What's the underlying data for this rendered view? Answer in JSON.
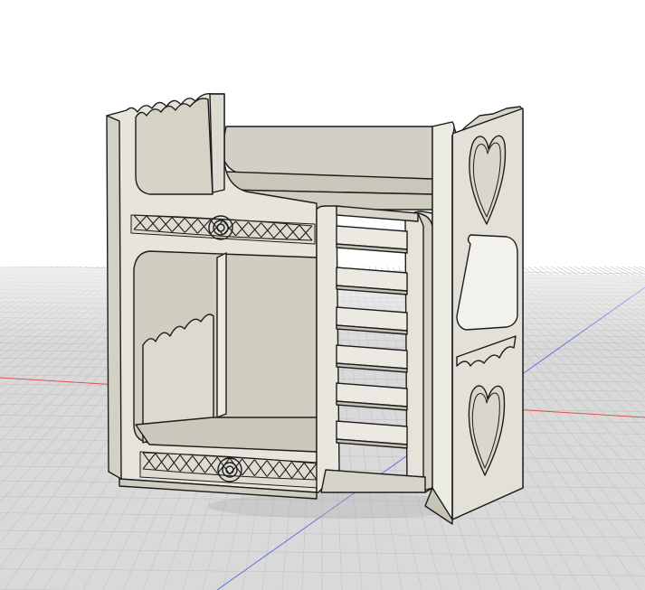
{
  "viewport": {
    "background": "#ffffff",
    "grid_color": "#c8c8c8",
    "grid_fill": "#d6d6d6",
    "x_axis_color": "#e05050",
    "y_axis_color": "#5a6ee0"
  },
  "model": {
    "body_color": "#e8e6de",
    "shade_color": "#d4d1c6",
    "dark_shade": "#bdb9ad",
    "edge_color": "#1c1c1c",
    "decor": [
      "celtic-knot-band",
      "heart-cutout",
      "wavy-crenellation",
      "ladder"
    ]
  }
}
